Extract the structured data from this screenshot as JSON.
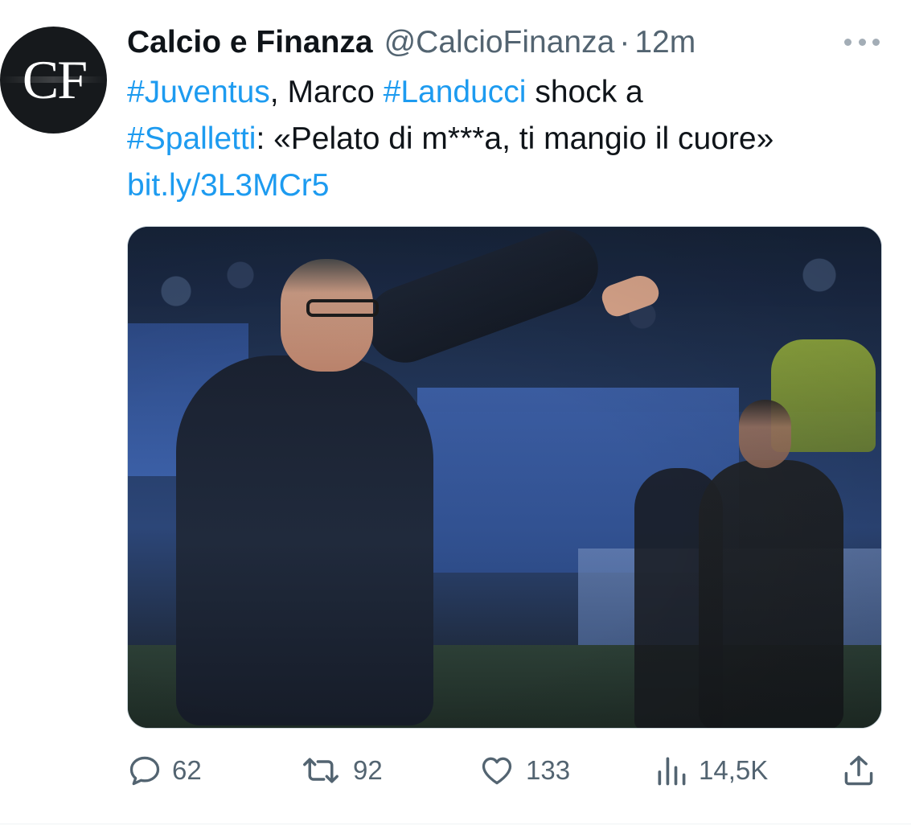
{
  "author": {
    "name": "Calcio e Finanza",
    "handle": "@CalcioFinanza",
    "separator": "·",
    "time": "12m",
    "avatar_text": "CF"
  },
  "tweet": {
    "tag1": "#Juventus",
    "text1": ", Marco ",
    "tag2": "#Landucci",
    "text2": " shock a ",
    "tag3": "#Spalletti",
    "text3": ": «Pelato di m***a, ti mangio il cuore»",
    "link": "bit.ly/3L3MCr5"
  },
  "actions": {
    "replies": "62",
    "retweets": "92",
    "likes": "133",
    "views": "14,5K"
  },
  "icons": {
    "more": "more-options-icon",
    "reply": "reply-icon",
    "retweet": "retweet-icon",
    "like": "heart-icon",
    "views": "views-icon",
    "share": "share-icon"
  },
  "colors": {
    "link": "#1d9bf0",
    "secondary_text": "#536471",
    "primary_text": "#0f1419"
  }
}
